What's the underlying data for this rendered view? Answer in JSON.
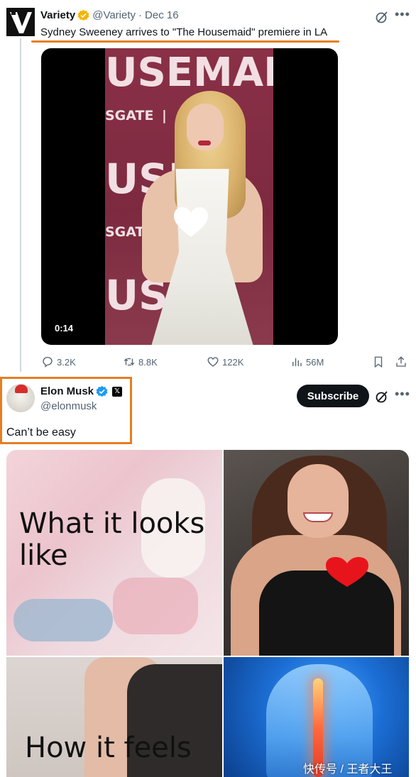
{
  "quoted_tweet": {
    "author_name": "Variety",
    "author_handle": "@Variety",
    "separator": "·",
    "date": "Dec 16",
    "text": "Sydney Sweeney arrives to \"The Housemaid\" premiere in LA",
    "video": {
      "duration": "0:14",
      "backdrop_text": [
        "USEMAID",
        "SGATE",
        "|",
        "USEI",
        "SGAT",
        "USE"
      ]
    },
    "stats": {
      "replies": "3.2K",
      "retweets": "8.8K",
      "likes": "122K",
      "views": "56M"
    },
    "icons": {
      "verified": "gold-check-icon",
      "grok": "grok-icon",
      "more": "more-icon"
    }
  },
  "main_tweet": {
    "author_name": "Elon Musk",
    "author_handle": "@elonmusk",
    "text": "Can’t be easy",
    "subscribe_label": "Subscribe",
    "icons": {
      "verified": "blue-check-icon",
      "affiliate": "x-logo-icon"
    }
  },
  "meme": {
    "top_caption": "What it looks like",
    "bottom_caption": "How it feels"
  },
  "watermark": "快传号 / 王者大王",
  "colors": {
    "highlight": "#e67e22",
    "gold_badge": "#f4b400",
    "blue_badge": "#1d9bf0",
    "text": "#0f1419",
    "muted": "#536471"
  }
}
